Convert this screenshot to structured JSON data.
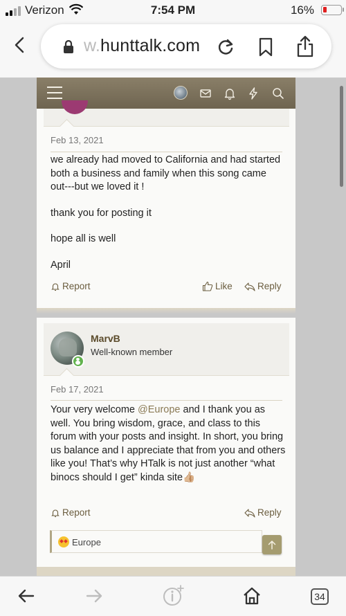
{
  "status_bar": {
    "carrier": "Verizon",
    "time": "7:54 PM",
    "battery_percent": "16%"
  },
  "browser": {
    "url_faded": "w.",
    "url_main": "hunttalk.com"
  },
  "post1": {
    "date": "Feb 13, 2021",
    "paragraphs": [
      "we already had moved to California and had started both a business and family when this song came out---but we loved it !",
      "thank you for posting it",
      "hope all is well",
      "April"
    ],
    "report_label": "Report",
    "like_label": "Like",
    "reply_label": "Reply"
  },
  "post2": {
    "username": "MarvB",
    "user_title": "Well-known member",
    "date": "Feb 17, 2021",
    "body_before_mention": "Your very welcome ",
    "mention": "@Europe",
    "body_after_mention": " and I thank you as well. You bring wisdom, grace, and class to this forum with your posts and insight. In short, you bring us balance and I appreciate that from you and others like you! That’s why HTalk is not just another “what binocs should I get” kinda site👍🏼",
    "report_label": "Report",
    "reply_label": "Reply",
    "reaction_user": "Europe"
  },
  "bottom_bar": {
    "tabs_count": "34"
  },
  "colors": {
    "nav_bar": "#7a705b",
    "accent_link": "#6b5d3f",
    "online": "#63b34e",
    "battery_low": "#e02020"
  }
}
